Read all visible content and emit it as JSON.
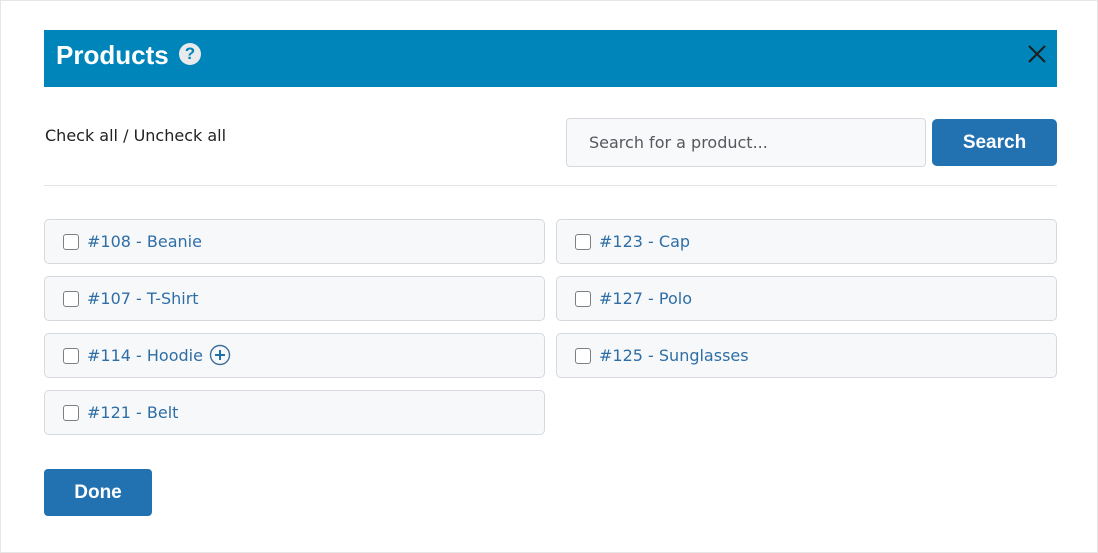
{
  "header": {
    "title": "Products",
    "help_glyph": "?",
    "bg_color": "#0085ba",
    "close_icon": "close-icon"
  },
  "toolbar": {
    "check_all": "Check all",
    "separator": " / ",
    "uncheck_all": "Uncheck all"
  },
  "search": {
    "placeholder": "Search for a product...",
    "value": "",
    "button_label": "Search"
  },
  "products": [
    {
      "label": "#108 - Beanie",
      "checked": false
    },
    {
      "label": "#123 - Cap",
      "checked": false
    },
    {
      "label": "#107 - T-Shirt",
      "checked": false
    },
    {
      "label": "#127 - Polo",
      "checked": false
    },
    {
      "label": "#114 - Hoodie",
      "checked": false,
      "expand_icon": "plus-circle-icon"
    },
    {
      "label": "#125 - Sunglasses",
      "checked": false
    },
    {
      "label": "#121 - Belt",
      "checked": false
    }
  ],
  "footer": {
    "done_label": "Done"
  },
  "colors": {
    "accent": "#2271b1",
    "link": "#2e6ea5"
  }
}
